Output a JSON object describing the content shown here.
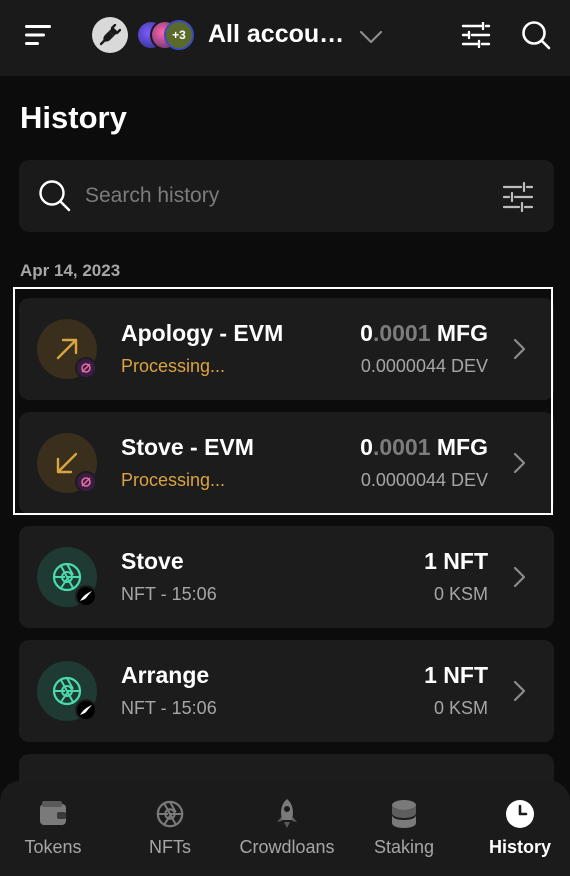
{
  "header": {
    "account_name": "All accou…",
    "avatars_extra": "+3",
    "icons": [
      "menu-icon",
      "plug-icon",
      "chevron-down-icon",
      "tune-icon",
      "search-icon"
    ]
  },
  "page": {
    "title": "History"
  },
  "search": {
    "placeholder": "Search history"
  },
  "date_group": "Apr 14, 2023",
  "transactions": [
    {
      "title": "Apology - EVM",
      "status": "Processing...",
      "amount_int": "0",
      "amount_frac": ".0001",
      "amount_symbol": " MFG",
      "fee": "0.0000044 DEV",
      "icon": "arrow-up-right-icon",
      "badge": "moonbase-icon"
    },
    {
      "title": "Stove - EVM",
      "status": "Processing...",
      "amount_int": "0",
      "amount_frac": ".0001",
      "amount_symbol": " MFG",
      "fee": "0.0000044 DEV",
      "icon": "arrow-down-left-icon",
      "badge": "moonbase-icon"
    },
    {
      "title": "Stove",
      "status": "NFT - 15:06",
      "amount": "1 NFT",
      "fee": "0 KSM",
      "icon": "aperture-icon",
      "badge": "kusama-icon"
    },
    {
      "title": "Arrange",
      "status": "NFT - 15:06",
      "amount": "1 NFT",
      "fee": "0 KSM",
      "icon": "aperture-icon",
      "badge": "kusama-icon"
    }
  ],
  "nav": [
    {
      "label": "Tokens",
      "icon": "wallet-icon"
    },
    {
      "label": "NFTs",
      "icon": "aperture-icon"
    },
    {
      "label": "Crowdloans",
      "icon": "rocket-icon"
    },
    {
      "label": "Staking",
      "icon": "database-icon"
    },
    {
      "label": "History",
      "icon": "clock-icon",
      "active": true
    }
  ],
  "colors": {
    "background": "#0c0c0c",
    "surface": "#1c1c1c",
    "processing": "#d9a441",
    "nft_accent": "#4cd9ac",
    "muted": "#a6a6a6"
  }
}
